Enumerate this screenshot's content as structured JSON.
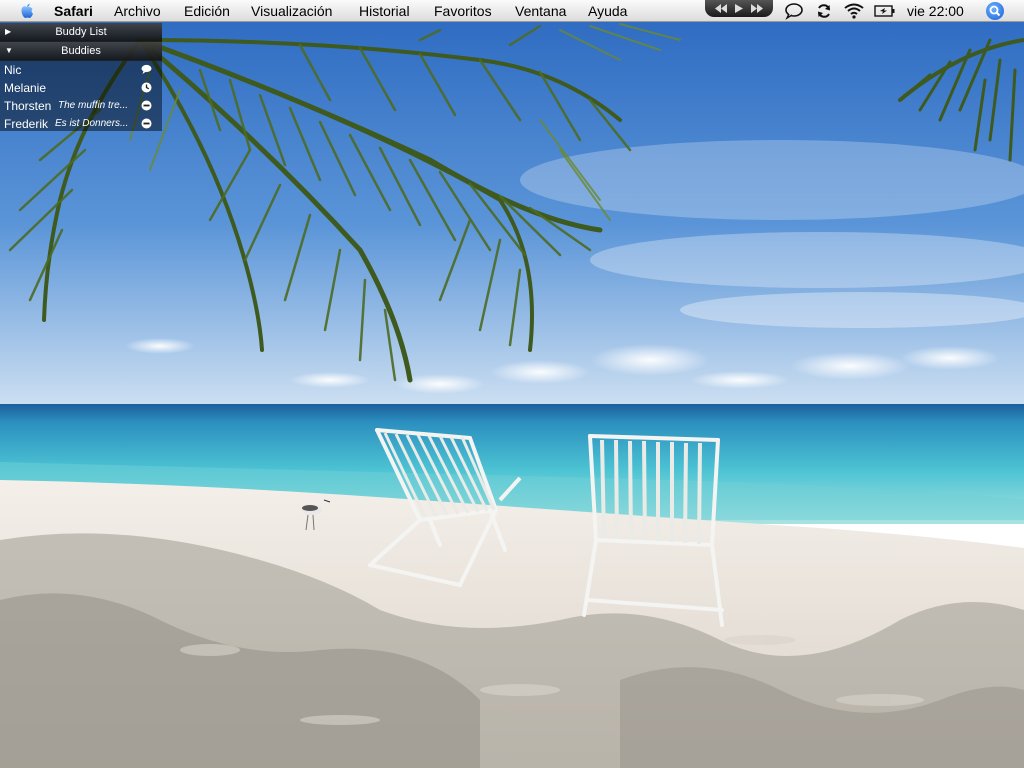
{
  "menubar": {
    "app_name": "Safari",
    "menus": [
      "Archivo",
      "Edición",
      "Visualización",
      "Historial",
      "Favoritos",
      "Ventana",
      "Ayuda"
    ],
    "clock": "vie 22:00",
    "status_icons": [
      "itunes-controls-icon",
      "speech-bubble-icon",
      "sync-icon",
      "wifi-icon",
      "battery-icon",
      "spotlight-icon"
    ]
  },
  "buddy_list": {
    "title": "Buddy List",
    "group": "Buddies",
    "buddies": [
      {
        "name": "Nic",
        "status": "",
        "icon": "speech-bubble-icon"
      },
      {
        "name": "Melanie",
        "status": "",
        "icon": "idle-clock-icon"
      },
      {
        "name": "Thorsten",
        "status": "The muffin tre...",
        "icon": "away-icon"
      },
      {
        "name": "Frederik",
        "status": "Es ist Donners...",
        "icon": "away-icon"
      }
    ]
  },
  "desktop": {
    "wallpaper": "tropical-beach-chairs"
  },
  "colors": {
    "sky_top": "#2f6fc4",
    "sky_bottom": "#cfe2f3",
    "sea": "#3fb9cf",
    "sand": "#f2ede6",
    "palm": "#3e5a1e"
  }
}
